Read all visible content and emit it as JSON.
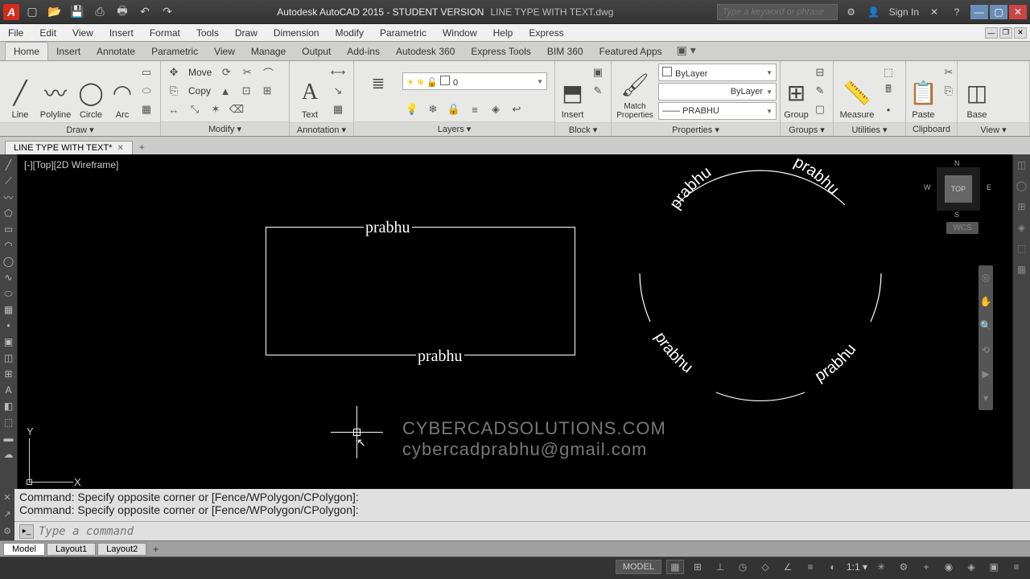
{
  "title": {
    "app": "Autodesk AutoCAD 2015 - STUDENT VERSION",
    "file": "LINE TYPE WITH TEXT.dwg",
    "search_placeholder": "Type a keyword or phrase",
    "sign_in": "Sign In"
  },
  "menu": [
    "File",
    "Edit",
    "View",
    "Insert",
    "Format",
    "Tools",
    "Draw",
    "Dimension",
    "Modify",
    "Parametric",
    "Window",
    "Help",
    "Express"
  ],
  "ribbon_tabs": [
    "Home",
    "Insert",
    "Annotate",
    "Parametric",
    "View",
    "Manage",
    "Output",
    "Add-ins",
    "Autodesk 360",
    "Express Tools",
    "BIM 360",
    "Featured Apps"
  ],
  "ribbon_active": "Home",
  "panels": {
    "draw": {
      "title": "Draw ▾",
      "items": [
        "Line",
        "Polyline",
        "Circle",
        "Arc"
      ]
    },
    "modify": {
      "title": "Modify ▾",
      "move": "Move",
      "copy": "Copy"
    },
    "annotation": {
      "title": "Annotation ▾",
      "text": "Text"
    },
    "layers": {
      "title": "Layers ▾",
      "btn": "Layer Properties",
      "current": "0"
    },
    "block": {
      "title": "Block ▾",
      "insert": "Insert"
    },
    "properties": {
      "title": "Properties ▾",
      "match": "Match Properties",
      "color": "ByLayer",
      "ltype": "ByLayer",
      "linetype_name": "PRABHU"
    },
    "groups": {
      "title": "Groups ▾",
      "group": "Group"
    },
    "utilities": {
      "title": "Utilities ▾",
      "measure": "Measure"
    },
    "clipboard": {
      "title": "Clipboard",
      "paste": "Paste"
    },
    "view": {
      "title": "View ▾",
      "base": "Base"
    }
  },
  "file_tab": {
    "name": "LINE TYPE WITH TEXT*"
  },
  "viewport_label": "[-][Top][2D Wireframe]",
  "viewcube": {
    "top": "TOP",
    "n": "N",
    "s": "S",
    "e": "E",
    "w": "W",
    "wcs": "WCS"
  },
  "drawing_text": "prabhu",
  "watermark": {
    "line1": "CYBERCADSOLUTIONS.COM",
    "line2": "cybercadprabhu@gmail.com"
  },
  "ucs": {
    "x": "X",
    "y": "Y"
  },
  "cmd_history": [
    "Command: Specify opposite corner or [Fence/WPolygon/CPolygon]:",
    "Command: Specify opposite corner or [Fence/WPolygon/CPolygon]:"
  ],
  "cmd_placeholder": "Type a command",
  "layout_tabs": [
    "Model",
    "Layout1",
    "Layout2"
  ],
  "status": {
    "model": "MODEL",
    "scale": "1:1"
  }
}
